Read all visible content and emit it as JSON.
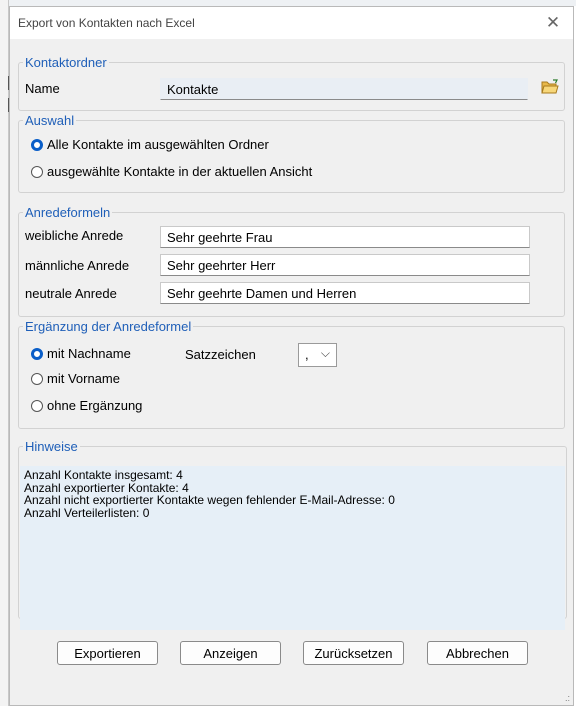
{
  "window": {
    "title": "Export von Kontakten nach Excel"
  },
  "kontaktordner": {
    "legend": "Kontaktordner",
    "name_label": "Name",
    "name_value": "Kontakte"
  },
  "auswahl": {
    "legend": "Auswahl",
    "options": [
      {
        "label": "Alle Kontakte im ausgewählten Ordner",
        "selected": true
      },
      {
        "label": "ausgewählte Kontakte in der aktuellen Ansicht",
        "selected": false
      }
    ]
  },
  "anredeformeln": {
    "legend": "Anredeformeln",
    "fields": [
      {
        "label": "weibliche Anrede",
        "value": "Sehr geehrte Frau"
      },
      {
        "label": "männliche Anrede",
        "value": "Sehr geehrter Herr"
      },
      {
        "label": "neutrale Anrede",
        "value": "Sehr geehrte Damen und Herren"
      }
    ]
  },
  "ergaenzung": {
    "legend": "Ergänzung der Anredeformel",
    "options": [
      {
        "label": "mit Nachname",
        "selected": true
      },
      {
        "label": "mit Vorname",
        "selected": false
      },
      {
        "label": "ohne Ergänzung",
        "selected": false
      }
    ],
    "satzzeichen_label": "Satzzeichen",
    "satzzeichen_value": ","
  },
  "hinweise": {
    "legend": "Hinweise",
    "lines": [
      "Anzahl Kontakte insgesamt: 4",
      "Anzahl exportierter Kontakte: 4",
      "Anzahl nicht exportierter Kontakte wegen fehlender E-Mail-Adresse: 0",
      "Anzahl Verteilerlisten: 0"
    ]
  },
  "buttons": {
    "export": "Exportieren",
    "show": "Anzeigen",
    "reset": "Zurücksetzen",
    "cancel": "Abbrechen"
  },
  "colors": {
    "accent": "#1f5fb8",
    "radio_selected": "#0a5ec8",
    "hint_bg": "#e6eff7"
  },
  "icons": {
    "close": "close-icon",
    "folder": "folder-open-icon"
  }
}
